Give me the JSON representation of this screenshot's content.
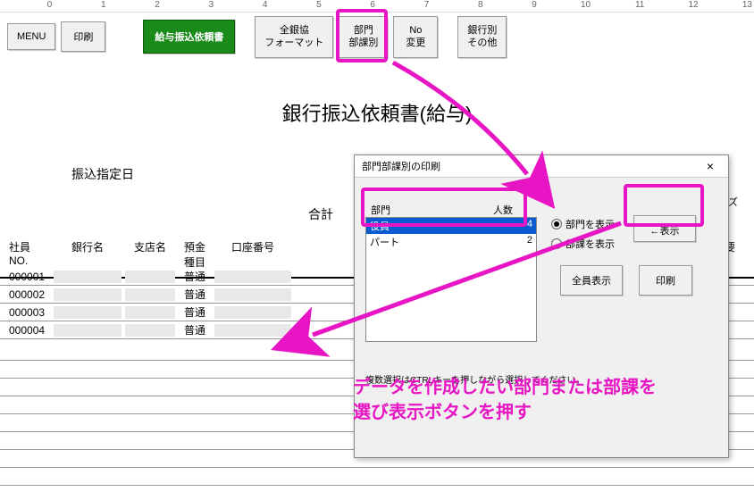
{
  "ruler": [
    "0",
    "1",
    "2",
    "3",
    "4",
    "5",
    "6",
    "7",
    "8",
    "9",
    "10",
    "11",
    "12",
    "13"
  ],
  "toolbar": {
    "menu": "MENU",
    "print": "印刷",
    "title_button": "給与振込依頼書",
    "zenginkyo": "全銀協\nフォーマット",
    "dept": "部門\n部課別",
    "no_change": "No\n変更",
    "bank_other": "銀行別\nその他"
  },
  "page_title": "銀行振込依頼書(給与)",
  "designated_date_label": "振込指定日",
  "total_label": "合計",
  "cells_label": "セルズ",
  "table": {
    "headers": {
      "id": "社員\nNO.",
      "bank": "銀行名",
      "branch": "支店名",
      "type": "預金\n種目",
      "account": "口座番号",
      "summary": "摘要"
    },
    "rows": [
      {
        "id": "000001",
        "type": "普通"
      },
      {
        "id": "000002",
        "type": "普通"
      },
      {
        "id": "000003",
        "type": "普通"
      },
      {
        "id": "000004",
        "type": "普通"
      }
    ]
  },
  "dialog": {
    "title": "部門部課別の印刷",
    "header_dept": "部門",
    "header_count": "人数",
    "list": [
      {
        "name": "役員",
        "count": "4",
        "selected": true
      },
      {
        "name": "パート",
        "count": "2",
        "selected": false
      }
    ],
    "radio_dept": "部門を表示",
    "radio_section": "部課を表示",
    "btn_show": "←表示",
    "btn_all": "全員表示",
    "btn_print": "印刷",
    "hint": "複数選択はCTRLキーを押しながら選択してください。"
  },
  "annotation_text": "データを作成したい部門または部課を\n選び表示ボタンを押す"
}
